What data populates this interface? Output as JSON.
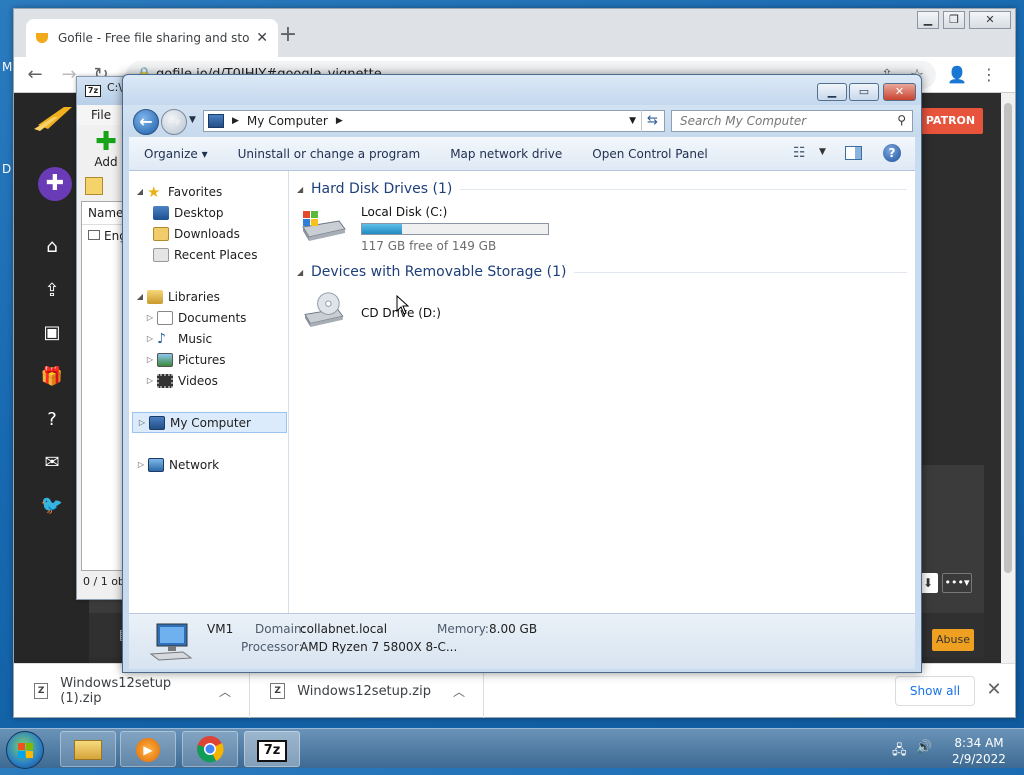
{
  "desktop": {
    "edge_letter_1": "M",
    "edge_letter_2": "D"
  },
  "chrome": {
    "tab_title": "Gofile - Free file sharing and stor",
    "new_tab_glyph": "+",
    "url": "gofile.io/d/T0JHIY#google_vignette",
    "downloads": [
      {
        "name": "Windows12setup (1).zip"
      },
      {
        "name": "Windows12setup.zip"
      }
    ],
    "show_all_label": "Show all"
  },
  "gofile": {
    "patron_label": "PATRON",
    "abuse_label": "Abuse",
    "more_label": "•••▾"
  },
  "sevenzip": {
    "title": "C:\\",
    "menu_file": "File",
    "add_label": "Add",
    "column_name": "Name",
    "first_item": "Eng",
    "status": "0 / 1 ob"
  },
  "explorer": {
    "breadcrumb": "My Computer",
    "search_placeholder": "Search My Computer",
    "commands": {
      "organize": "Organize ▾",
      "uninstall": "Uninstall or change a program",
      "map_drive": "Map network drive",
      "control_panel": "Open Control Panel"
    },
    "nav": {
      "favorites": "Favorites",
      "desktop": "Desktop",
      "downloads": "Downloads",
      "recent_places": "Recent Places",
      "libraries": "Libraries",
      "documents": "Documents",
      "music": "Music",
      "pictures": "Pictures",
      "videos": "Videos",
      "my_computer": "My Computer",
      "network": "Network"
    },
    "groups": {
      "hdd": "Hard Disk Drives (1)",
      "removable": "Devices with Removable Storage (1)"
    },
    "local_disk": {
      "name": "Local Disk (C:)",
      "free_text": "117 GB free of 149 GB",
      "used_fraction": 0.215
    },
    "cd_drive": {
      "name": "CD Drive (D:)"
    },
    "details": {
      "computer_name": "VM1",
      "domain_label": "Domain:",
      "domain_value": "collabnet.local",
      "memory_label": "Memory:",
      "memory_value": "8.00 GB",
      "processor_label": "Processor:",
      "processor_value": "AMD Ryzen 7 5800X 8-C..."
    }
  },
  "taskbar": {
    "time": "8:34 AM",
    "date": "2/9/2022"
  }
}
